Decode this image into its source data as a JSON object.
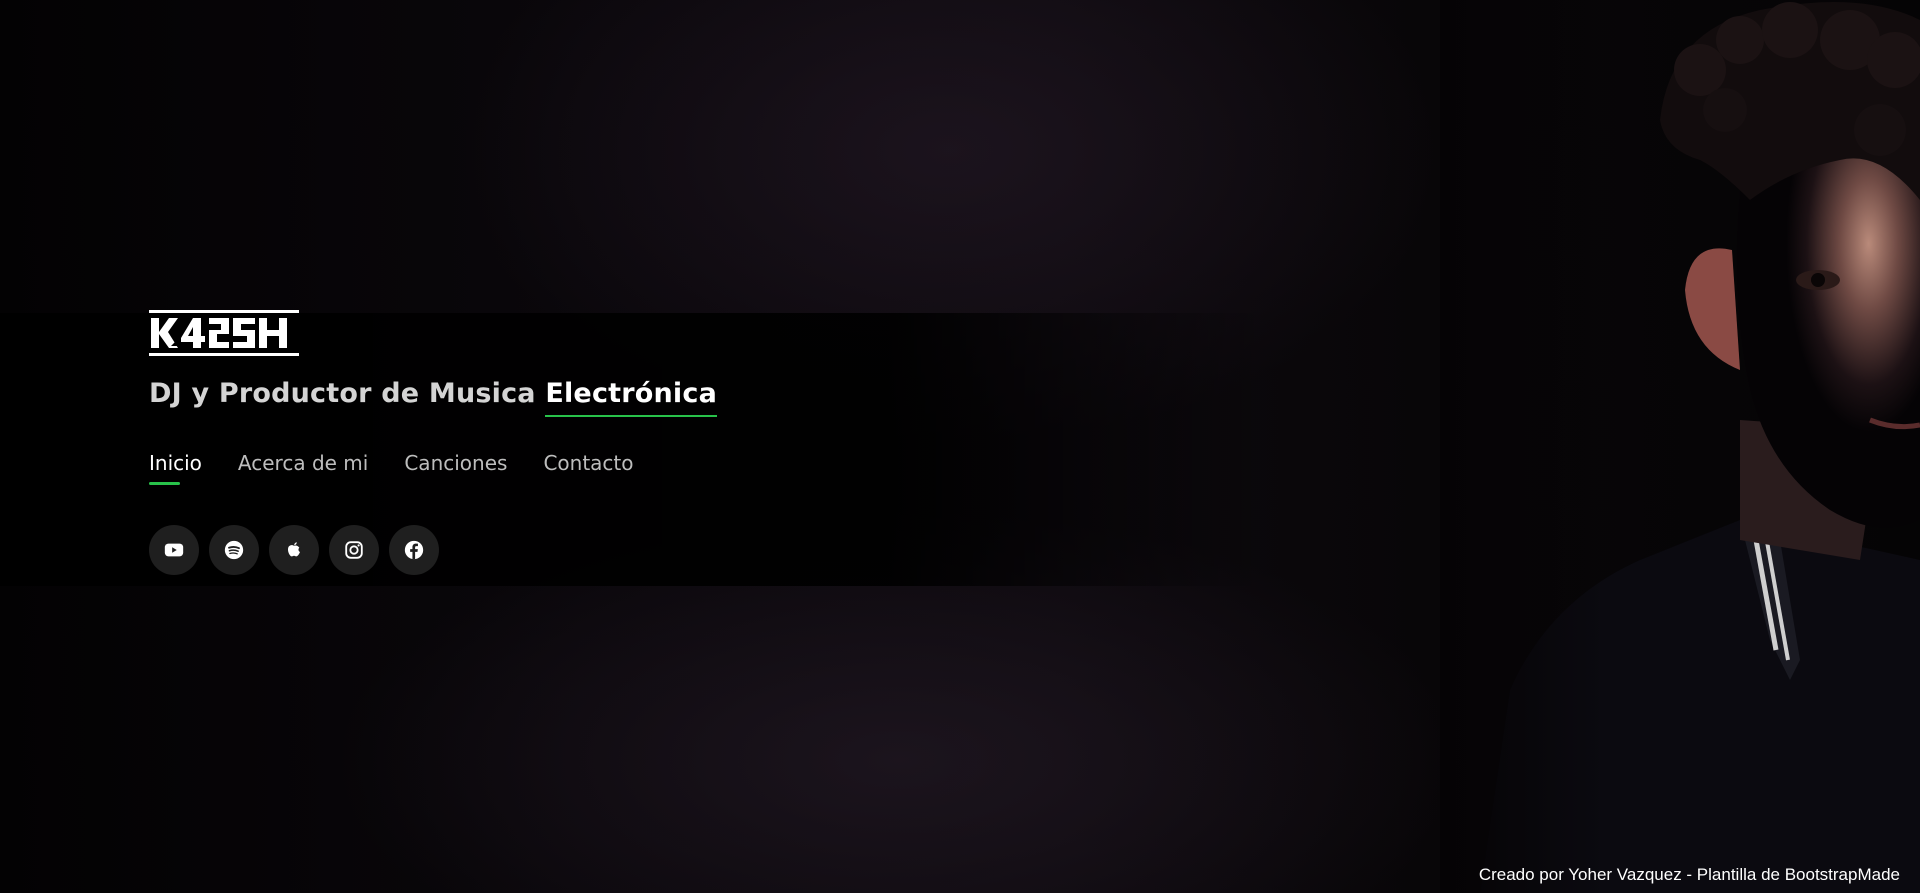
{
  "hero": {
    "logo_text": "K42SH",
    "subtitle_prefix": "DJ y Productor de Musica",
    "subtitle_accent": "Electrónica"
  },
  "nav": {
    "items": [
      {
        "label": "Inicio",
        "active": true
      },
      {
        "label": "Acerca de mi",
        "active": false
      },
      {
        "label": "Canciones",
        "active": false
      },
      {
        "label": "Contacto",
        "active": false
      }
    ]
  },
  "social": {
    "icons": [
      "youtube-icon",
      "spotify-icon",
      "apple-icon",
      "instagram-icon",
      "facebook-icon"
    ]
  },
  "footer": {
    "credit": "Creado por Yoher Vazquez - Plantilla de BootstrapMade"
  },
  "colors": {
    "accent": "#28c24a",
    "background": "#050305",
    "button_bg": "#1f1f1f"
  }
}
